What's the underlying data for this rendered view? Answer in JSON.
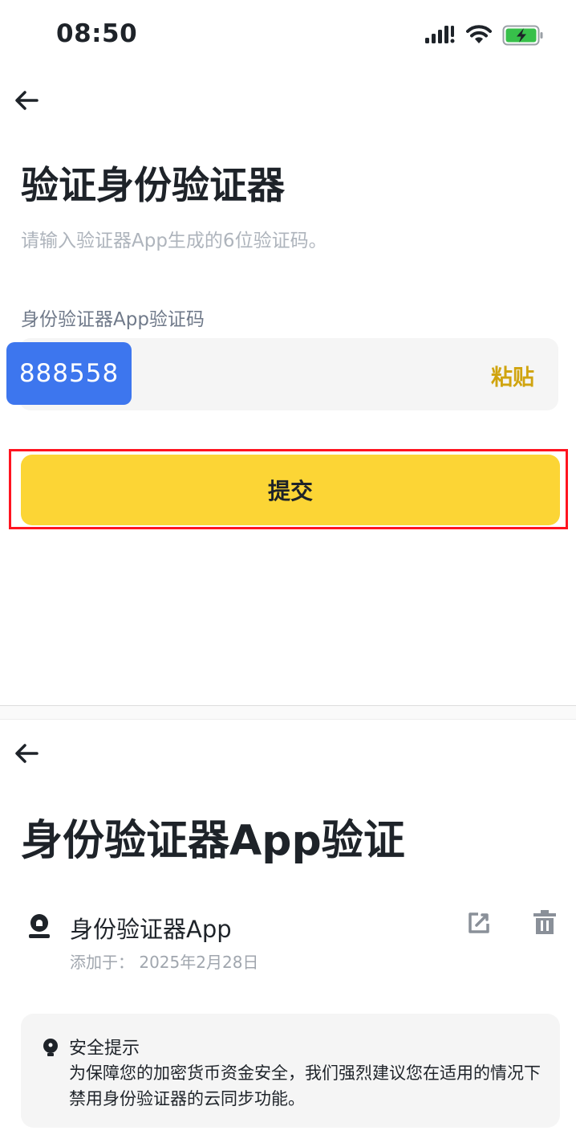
{
  "status_bar": {
    "time": "08:50"
  },
  "verify_screen": {
    "title": "验证身份验证器",
    "subtitle": "请输入验证器App生成的6位验证码。",
    "field_label": "身份验证器App验证码",
    "code_value": "888558",
    "paste_label": "粘贴",
    "submit_label": "提交"
  },
  "auth_screen": {
    "title": "身份验证器App验证",
    "authenticator_name": "身份验证器App",
    "added_text": "添加于： 2025年2月28日",
    "tip_title": "安全提示",
    "tip_body": "为保障您的加密货币资金安全，我们强烈建议您在适用的情况下禁用身份验证器的云同步功能。"
  },
  "colors": {
    "accent_yellow": "#FCD535",
    "paste_text": "#D0A40F",
    "code_badge": "#3D76EE",
    "highlight_border": "#FF1420",
    "battery_green": "#37C04A"
  },
  "icons": [
    "back-arrow-icon",
    "signal-icon",
    "wifi-icon",
    "battery-charging-icon",
    "authenticator-icon",
    "edit-icon",
    "trash-icon",
    "bulb-icon"
  ]
}
